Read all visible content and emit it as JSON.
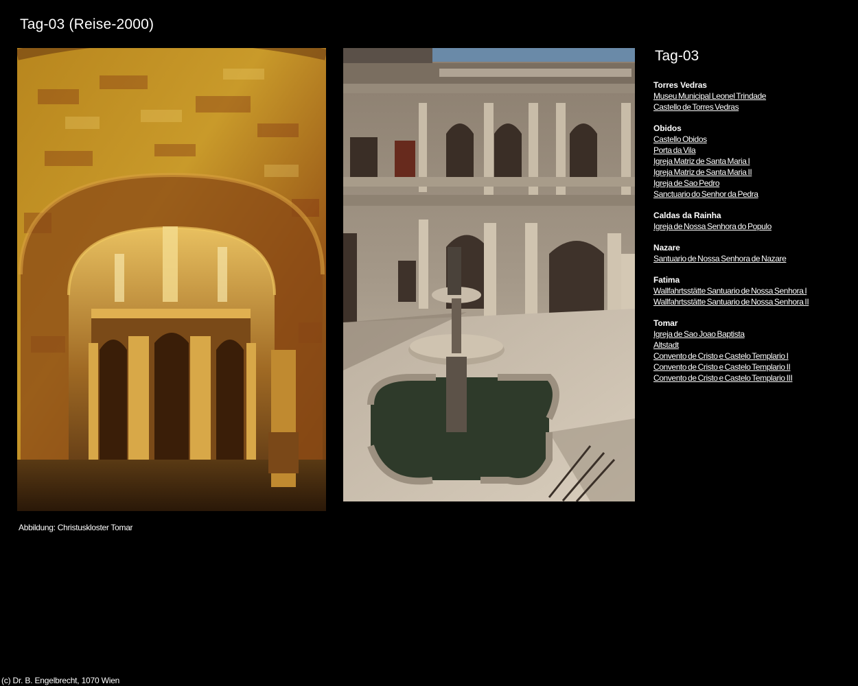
{
  "page": {
    "title": "Tag-03 (Reise-2000)"
  },
  "photos": {
    "caption": "Abbildung: Christuskloster Tomar"
  },
  "sidebar": {
    "title": "Tag-03",
    "groups": [
      {
        "name": "Torres Vedras",
        "links": [
          "Museu Municipal Leonel Trindade",
          "Castello de Torres Vedras"
        ]
      },
      {
        "name": "Obidos",
        "links": [
          "Castello Obidos",
          "Porta da Vila",
          "Igreja Matriz de Santa Maria I",
          "Igreja Matriz de Santa Maria II",
          "Igreja de Sao Pedro",
          "Sanctuario do Senhor da Pedra"
        ]
      },
      {
        "name": "Caldas da Rainha",
        "links": [
          "Igreja de Nossa Senhora do Populo"
        ]
      },
      {
        "name": "Nazare",
        "links": [
          "Santuario de Nossa Senhora de Nazare"
        ]
      },
      {
        "name": "Fatima",
        "links": [
          "Wallfahrtsstätte Santuario de Nossa Senhora I",
          "Wallfahrtsstätte Santuario de Nossa Senhora II"
        ]
      },
      {
        "name": "Tomar",
        "links": [
          "Igreja de Sao Joao Baptista",
          "Altstadt",
          "Convento de Cristo e Castelo Templario I",
          "Convento de Cristo e Castelo Templario II",
          "Convento de Cristo e Castelo Templario III"
        ]
      }
    ]
  },
  "footer": {
    "copyright": "(c) Dr. B. Engelbrecht, 1070 Wien"
  }
}
